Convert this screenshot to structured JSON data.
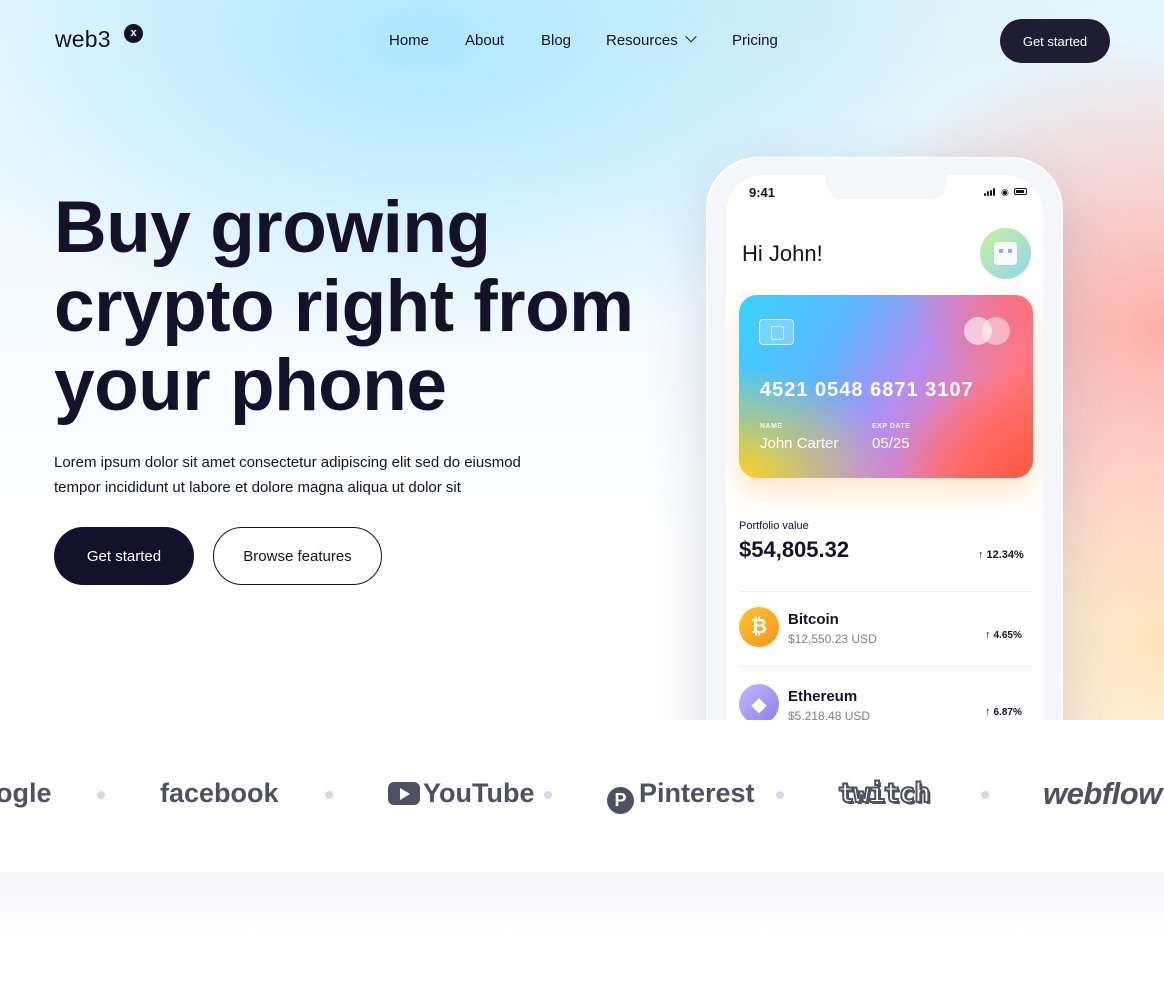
{
  "brand": {
    "name": "web3",
    "badge": "x"
  },
  "nav": {
    "items": [
      "Home",
      "About",
      "Blog",
      "Resources",
      "Pricing"
    ],
    "cta": "Get started"
  },
  "hero": {
    "title": "Buy growing crypto right from your phone",
    "subtitle": "Lorem ipsum dolor sit amet consectetur adipiscing elit sed do eiusmod tempor incididunt ut labore et dolore magna aliqua ut dolor sit",
    "primary_cta": "Get started",
    "secondary_cta": "Browse features"
  },
  "phone": {
    "time": "9:41",
    "greeting": "Hi John!",
    "card": {
      "number": "4521 0548 6871 3107",
      "name_label": "NAME",
      "name": "John Carter",
      "exp_label": "EXP DATE",
      "exp": "05/25"
    },
    "portfolio": {
      "label": "Portfolio value",
      "value": "$54,805.32",
      "change": "12.34%"
    },
    "coins": [
      {
        "name": "Bitcoin",
        "usd": "$12,550.23 USD",
        "change": "4.65%",
        "symbol": "₿"
      },
      {
        "name": "Ethereum",
        "usd": "$5,218.48 USD",
        "change": "6.87%",
        "symbol": "◆"
      }
    ]
  },
  "partners": [
    "ogle",
    "facebook",
    "YouTube",
    "Pinterest",
    "twitch",
    "webflow"
  ],
  "colors": {
    "ink": "#14112b",
    "nav_button": "#1f1d33",
    "logo_gray": "#4f5061",
    "bitcoin": "#f7931a",
    "ethereum": "#8f7dea"
  },
  "icons": [
    "chevron-down-icon",
    "signal-icon",
    "wifi-icon",
    "battery-icon",
    "chip-icon",
    "mastercard-icon",
    "arrow-up-icon",
    "bitcoin-icon",
    "ethereum-icon",
    "youtube-play-icon",
    "pinterest-icon"
  ]
}
